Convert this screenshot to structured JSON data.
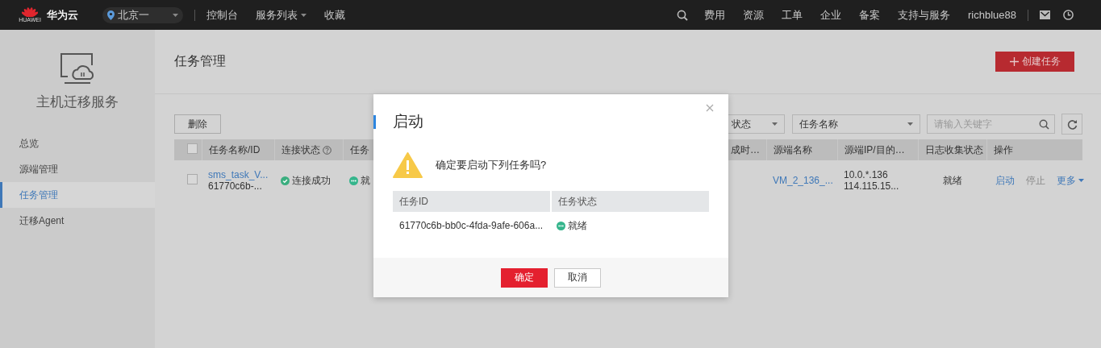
{
  "topbar": {
    "logo_caption": "HUAWEI",
    "brand": "华为云",
    "region": "北京一",
    "nav": [
      {
        "label": "控制台",
        "has_menu": false
      },
      {
        "label": "服务列表",
        "has_menu": true
      },
      {
        "label": "收藏",
        "has_menu": false
      }
    ],
    "right_nav": [
      "费用",
      "资源",
      "工单",
      "企业",
      "备案",
      "支持与服务"
    ],
    "user": "richblue88"
  },
  "sidebar": {
    "service_title": "主机迁移服务",
    "items": [
      {
        "label": "总览",
        "selected": false
      },
      {
        "label": "源端管理",
        "selected": false
      },
      {
        "label": "任务管理",
        "selected": true
      },
      {
        "label": "迁移Agent",
        "selected": false
      }
    ]
  },
  "page": {
    "title": "任务管理",
    "create_button": "创建任务",
    "delete_button": "删除",
    "filters": [
      "状态",
      "任务名称"
    ],
    "search": {
      "placeholder": "请输入关键字"
    },
    "table": {
      "header_checked": false,
      "columns": [
        {
          "label": "任务名称/ID",
          "help": false
        },
        {
          "label": "连接状态",
          "help": true
        },
        {
          "label": "任务",
          "help": false
        },
        {
          "label": "成时…",
          "help": false
        },
        {
          "label": "源端名称",
          "help": false
        },
        {
          "label": "源端IP/目的…",
          "help": false
        },
        {
          "label": "日志收集状态",
          "help": false
        },
        {
          "label": "操作",
          "help": false
        }
      ],
      "rows": [
        {
          "checked": false,
          "name": "sms_task_V...",
          "id": "61770c6b-...",
          "connection": {
            "label": "连接成功",
            "kind": "success"
          },
          "task_status": {
            "label": "就",
            "kind": "ready"
          },
          "source_name": "VM_2_136_...",
          "ips": [
            "10.0.*.136",
            "114.115.15..."
          ],
          "log_status": "就绪",
          "actions": [
            {
              "label": "启动",
              "enabled": true,
              "menu": false
            },
            {
              "label": "停止",
              "enabled": false,
              "menu": false
            },
            {
              "label": "更多",
              "enabled": true,
              "menu": true
            }
          ]
        }
      ]
    }
  },
  "dialog": {
    "title": "启动",
    "message": "确定要启动下列任务吗?",
    "columns": [
      "任务ID",
      "任务状态"
    ],
    "rows": [
      {
        "id": "61770c6b-bb0c-4fda-9afe-606a...",
        "status": {
          "label": "就绪",
          "kind": "ready"
        }
      }
    ],
    "buttons": [
      {
        "label": "确定",
        "kind": "primary"
      },
      {
        "label": "取消",
        "kind": "secondary"
      }
    ]
  }
}
